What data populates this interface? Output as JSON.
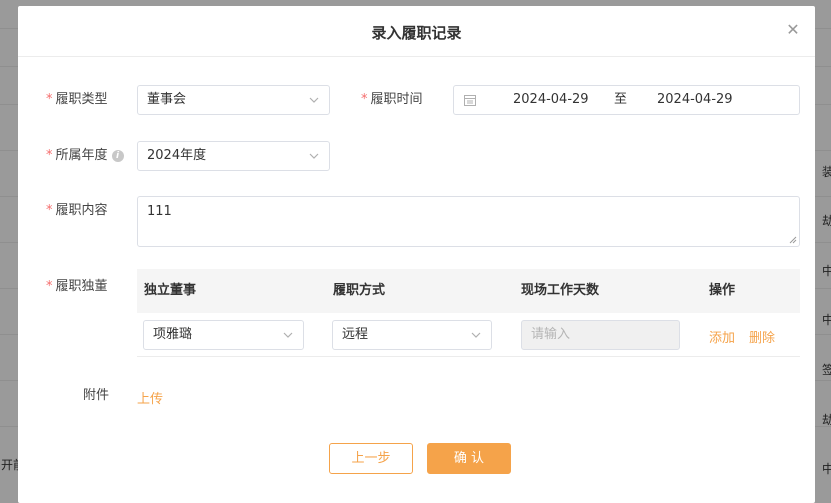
{
  "background": {
    "left_text": "开前",
    "right_chars": [
      "装",
      "劫",
      "中",
      "中",
      "签",
      "劫",
      "中"
    ]
  },
  "modal": {
    "title": "录入履职记录",
    "close_icon": "close-icon"
  },
  "form": {
    "duty_type": {
      "label": "履职类型",
      "value": "董事会"
    },
    "duty_time": {
      "label": "履职时间",
      "start": "2024-04-29",
      "separator": "至",
      "end": "2024-04-29"
    },
    "year": {
      "label": "所属年度",
      "value": "2024年度"
    },
    "content": {
      "label": "履职内容",
      "value": "111"
    },
    "independent": {
      "label": "履职独董",
      "columns": [
        "独立董事",
        "履职方式",
        "现场工作天数",
        "操作"
      ],
      "row": {
        "director": "项雅璐",
        "method": "远程",
        "days_placeholder": "请输入",
        "add": "添加",
        "delete": "删除"
      }
    },
    "attachment": {
      "label": "附件",
      "upload": "上传"
    }
  },
  "buttons": {
    "prev": "上一步",
    "confirm": "确 认"
  },
  "colors": {
    "accent": "#f5a34a",
    "required": "#f56c6c",
    "border": "#dcdfe6"
  }
}
